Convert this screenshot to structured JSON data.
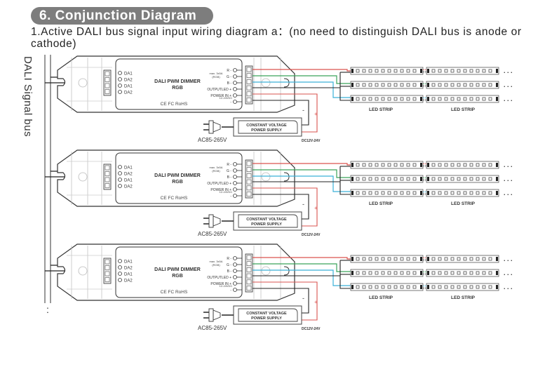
{
  "section_title": "6. Conjunction Diagram",
  "description": "1.Active DALI bus signal input wiring diagram a：(no need to distinguish DALI bus is anode or  cathode)",
  "bus_label": "DALI Signal bus",
  "bus_continuation": ":",
  "dimmer": {
    "name_line1": "DALI PWM DIMMER",
    "name_line2": "RGB",
    "certifications": "CE FC RoHS",
    "inputs": [
      "DA1",
      "DA2",
      "DA1",
      "DA2"
    ],
    "rating": "max. 3x5A",
    "rating_sub": "(RGB)",
    "outputs": [
      "R -",
      "G -",
      "B -",
      "OUTPUTLED +",
      "POWER IN +",
      "-"
    ],
    "power_in_sub": "12-24VDC"
  },
  "power_supply": {
    "label_line1": "CONSTANT VOLTAGE",
    "label_line2": "POWER SUPPLY",
    "ac_label": "AC85-265V",
    "dc_label": "DC12V-24V",
    "minus": "-",
    "plus": "+"
  },
  "led_strip": {
    "label": "LED STRIP",
    "ellipsis": ". . .",
    "leds_per_strip": 10
  },
  "wire_colors": {
    "red": "#d9534f",
    "green": "#3aa35a",
    "blue": "#3ab0d8",
    "black": "#222222"
  },
  "units": [
    {
      "id": 1
    },
    {
      "id": 2
    },
    {
      "id": 3
    }
  ]
}
